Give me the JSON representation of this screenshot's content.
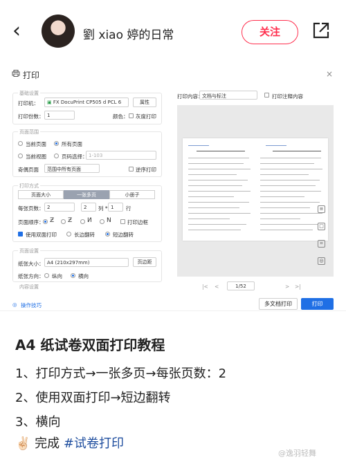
{
  "header": {
    "back_icon": "chevron-left-icon",
    "username": "劉 xiao 婷的日常",
    "follow_label": "关注",
    "share_icon": "share-icon",
    "accent": "#ff2e4d"
  },
  "print_dialog": {
    "title": "打印",
    "close_glyph": "×",
    "basic": {
      "section_label": "基础设置",
      "printer_label": "打印机：",
      "printer_value": "FX DocuPrint CP505 d PCL 6",
      "properties_button": "属性",
      "copies_label": "打印份数：",
      "copies_value": "1",
      "color_label": "颜色：",
      "grayscale_label": "灰度打印"
    },
    "page_range": {
      "section_label": "页面范围",
      "current_page": "当前页面",
      "all_pages": "所有页面",
      "current_view": "当前视图",
      "page_select": "页码选择：",
      "page_select_placeholder": "1-103",
      "odd_even_label": "奇偶页面",
      "odd_even_value": "范围中所有页面",
      "reverse_label": "逆序打印"
    },
    "print_mode": {
      "section_label": "打印方式",
      "tabs": [
        "页面大小",
        "一张多页",
        "小册子"
      ],
      "per_sheet_label": "每张页数：",
      "per_sheet_value": "2",
      "cols_value": "2",
      "cols_label": "列 *",
      "rows_value": "1",
      "rows_label": "行",
      "order_label": "页面顺序：",
      "print_border": "打印边框",
      "duplex_label": "使用双面打印",
      "long_edge": "长边翻转",
      "short_edge": "短边翻转"
    },
    "page_setup": {
      "section_label": "页面设置",
      "paper_size_label": "纸张大小：",
      "paper_size_value": "A4 (210x297mm)",
      "margins_button": "页边距",
      "orientation_label": "纸张方向：",
      "portrait": "纵向",
      "landscape": "横向",
      "content_label": "内容设置"
    },
    "tips_label": "操作技巧",
    "print_content_label": "打印内容：",
    "print_content_value": "文档与标注",
    "print_comments_label": "打印注释内容",
    "page_indicator": "1/52",
    "multi_doc_button": "多文档打印",
    "print_button": "打印",
    "print_button_color": "#1f6fe5"
  },
  "post": {
    "title": "A4 纸试卷双面打印教程",
    "steps": [
      "1、打印方式→一张多页→每张页数：2",
      "2、使用双面打印→短边翻转",
      "3、横向"
    ],
    "emoji": "✌🏻",
    "done_text": "完成 ",
    "hashtag": "#试卷打印"
  },
  "watermark": "@逸羽轻舞"
}
